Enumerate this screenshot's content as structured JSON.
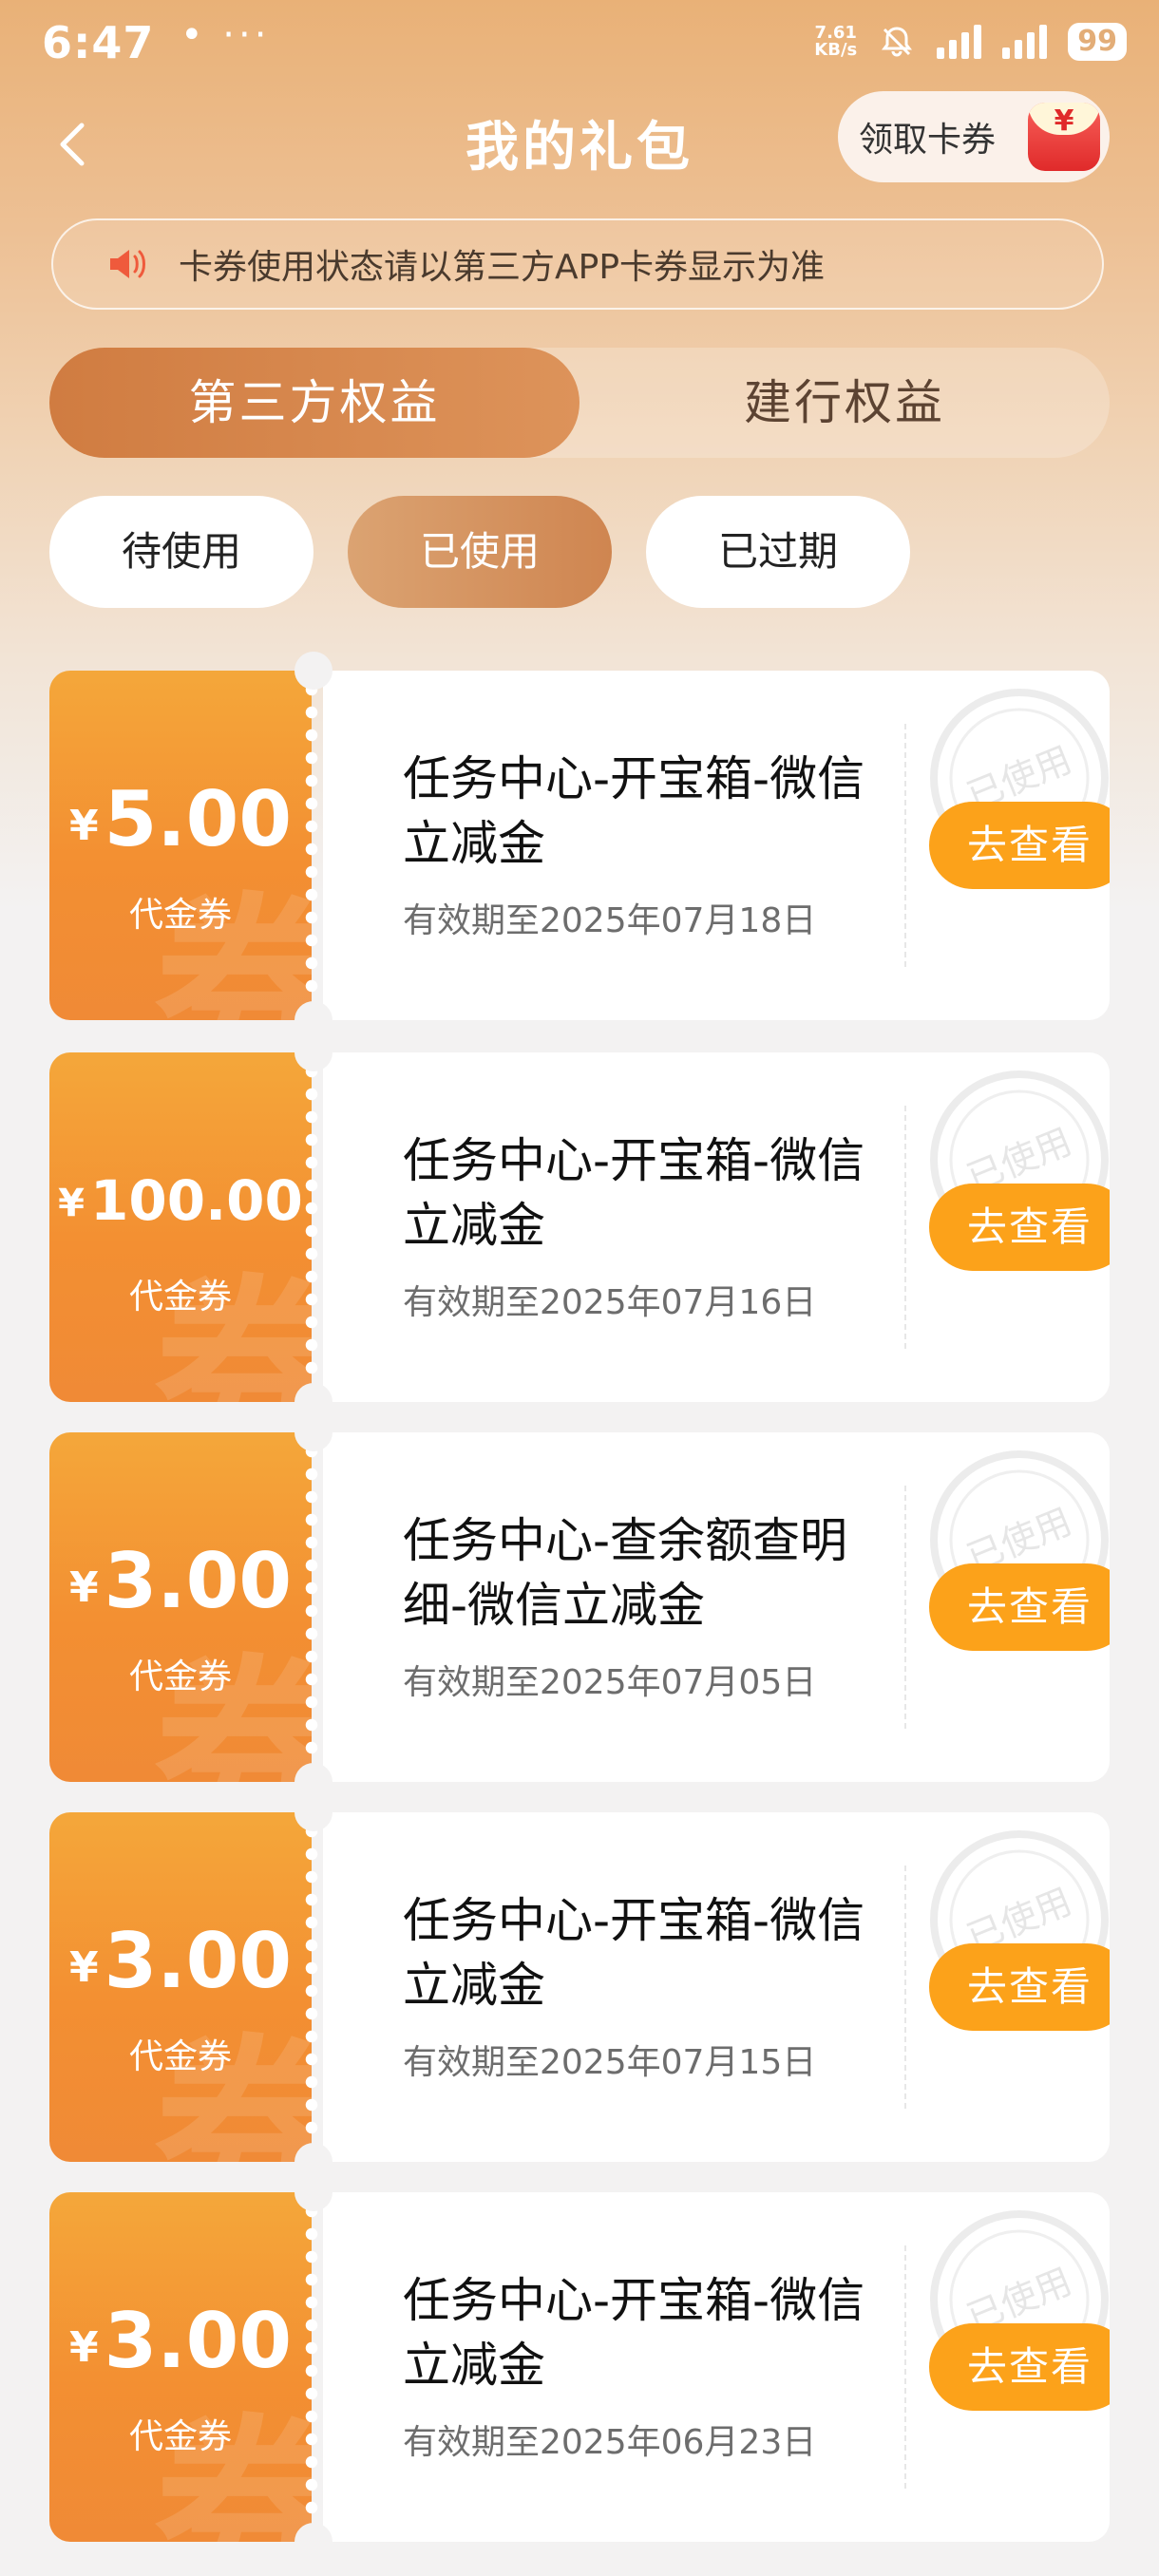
{
  "status_bar": {
    "time": "6:47",
    "dots": "• ···",
    "net_speed_top": "7.61",
    "net_speed_bottom": "KB/s",
    "battery": "99"
  },
  "header": {
    "title": "我的礼包",
    "claim_button": "领取卡券",
    "claim_icon_symbol": "¥"
  },
  "notice": "卡券使用状态请以第三方APP卡券显示为准",
  "tabs": [
    {
      "label": "第三方权益",
      "active": true
    },
    {
      "label": "建行权益",
      "active": false
    }
  ],
  "filters": [
    {
      "label": "待使用",
      "selected": false
    },
    {
      "label": "已使用",
      "selected": true
    },
    {
      "label": "已过期",
      "selected": false
    }
  ],
  "coupons": [
    {
      "currency": "¥",
      "amount": "5.00",
      "type": "代金券",
      "watermark": "券",
      "name": "任务中心-开宝箱-微信立减金",
      "validity": "有效期至2025年07月18日",
      "button": "去查看",
      "stamp": "已使用"
    },
    {
      "currency": "¥",
      "amount": "100.00",
      "type": "代金券",
      "watermark": "券",
      "name": "任务中心-开宝箱-微信立减金",
      "validity": "有效期至2025年07月16日",
      "button": "去查看",
      "stamp": "已使用"
    },
    {
      "currency": "¥",
      "amount": "3.00",
      "type": "代金券",
      "watermark": "券",
      "name": "任务中心-查余额查明细-微信立减金",
      "validity": "有效期至2025年07月05日",
      "button": "去查看",
      "stamp": "已使用"
    },
    {
      "currency": "¥",
      "amount": "3.00",
      "type": "代金券",
      "watermark": "券",
      "name": "任务中心-开宝箱-微信立减金",
      "validity": "有效期至2025年07月15日",
      "button": "去查看",
      "stamp": "已使用"
    },
    {
      "currency": "¥",
      "amount": "3.00",
      "type": "代金券",
      "watermark": "券",
      "name": "任务中心-开宝箱-微信立减金",
      "validity": "有效期至2025年06月23日",
      "button": "去查看",
      "stamp": "已使用"
    }
  ],
  "colors": {
    "accent_orange": "#fca21a",
    "tab_active": "#d07c41",
    "coupon_left": "#f39a34"
  }
}
